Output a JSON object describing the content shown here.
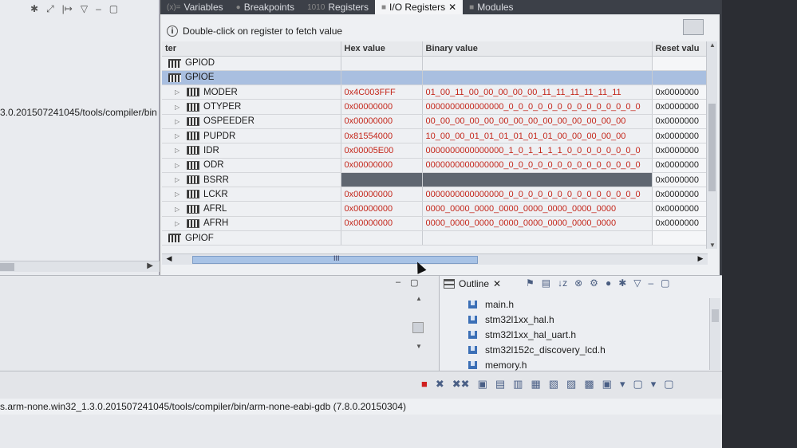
{
  "left_panel": {
    "toolbar_glyphs": [
      "✱",
      "⤢",
      "|↦",
      "▽",
      "–",
      "▢"
    ],
    "path_text": "3.0.201507241045/tools/compiler/bin"
  },
  "tabs": [
    {
      "label": "Variables",
      "glyph": "(x)="
    },
    {
      "label": "Breakpoints",
      "glyph": "●"
    },
    {
      "label": "Registers",
      "glyph": "1010"
    },
    {
      "label": "I/O Registers",
      "glyph": "■",
      "active": true,
      "closable": true
    },
    {
      "label": "Modules",
      "glyph": "■"
    }
  ],
  "info": {
    "text": "Double-click on register to fetch value",
    "icon": "info-icon"
  },
  "columns": [
    "ter",
    "Hex value",
    "Binary value",
    "Reset valu"
  ],
  "rows": [
    {
      "kind": "group",
      "name": "GPIOD",
      "hex": "",
      "bin": "",
      "reset": ""
    },
    {
      "kind": "group",
      "name": "GPIOE",
      "hex": "",
      "bin": "",
      "reset": "",
      "selected": true
    },
    {
      "kind": "reg",
      "name": "MODER",
      "hex": "0x4C003FFF",
      "bin": "01_00_11_00_00_00_00_00_11_11_11_11_11_11",
      "reset": "0x0000000"
    },
    {
      "kind": "reg",
      "name": "OTYPER",
      "hex": "0x00000000",
      "bin": "0000000000000000_0_0_0_0_0_0_0_0_0_0_0_0_0_0",
      "reset": "0x0000000"
    },
    {
      "kind": "reg",
      "name": "OSPEEDER",
      "hex": "0x00000000",
      "bin": "00_00_00_00_00_00_00_00_00_00_00_00_00_00",
      "reset": "0x0000000"
    },
    {
      "kind": "reg",
      "name": "PUPDR",
      "hex": "0x81554000",
      "bin": "10_00_00_01_01_01_01_01_01_00_00_00_00_00",
      "reset": "0x0000000"
    },
    {
      "kind": "reg",
      "name": "IDR",
      "hex": "0x00005E00",
      "bin": "0000000000000000_1_0_1_1_1_1_0_0_0_0_0_0_0_0",
      "reset": "0x0000000"
    },
    {
      "kind": "reg",
      "name": "ODR",
      "hex": "0x00000000",
      "bin": "0000000000000000_0_0_0_0_0_0_0_0_0_0_0_0_0_0",
      "reset": "0x0000000"
    },
    {
      "kind": "reg",
      "name": "BSRR",
      "hex": "",
      "bin": "",
      "reset": "0x0000000",
      "dark": true
    },
    {
      "kind": "reg",
      "name": "LCKR",
      "hex": "0x00000000",
      "bin": "0000000000000000_0_0_0_0_0_0_0_0_0_0_0_0_0_0",
      "reset": "0x0000000"
    },
    {
      "kind": "reg",
      "name": "AFRL",
      "hex": "0x00000000",
      "bin": "0000_0000_0000_0000_0000_0000_0000_0000",
      "reset": "0x0000000"
    },
    {
      "kind": "reg",
      "name": "AFRH",
      "hex": "0x00000000",
      "bin": "0000_0000_0000_0000_0000_0000_0000_0000",
      "reset": "0x0000000"
    },
    {
      "kind": "group",
      "name": "GPIOF",
      "hex": "",
      "bin": "",
      "reset": ""
    }
  ],
  "hscroll_grip": "III",
  "outline": {
    "title": "Outline",
    "items": [
      "main.h",
      "stm32l1xx_hal.h",
      "stm32l1xx_hal_uart.h",
      "stm32l152c_discovery_lcd.h",
      "memory.h"
    ],
    "tool_glyphs": [
      "⚑",
      "▤",
      "↓z",
      "⊗",
      "⚙",
      "●",
      "✱",
      "▽",
      "–",
      "▢"
    ]
  },
  "console_panel": {
    "control_glyphs": [
      "–",
      "▢"
    ],
    "toolbar_glyphs": [
      "■",
      "✖",
      "✖✖",
      "▣",
      "▤",
      "▥",
      "▦",
      "▧",
      "▨",
      "▩",
      "▣",
      "▾",
      "▢",
      "▾",
      "▢"
    ],
    "output_line": "s.arm-none.win32_1.3.0.201507241045/tools/compiler/bin/arm-none-eabi-gdb (7.8.0.20150304)"
  },
  "colors": {
    "value_red": "#c4261a",
    "selection_blue": "#a9bfe0"
  }
}
